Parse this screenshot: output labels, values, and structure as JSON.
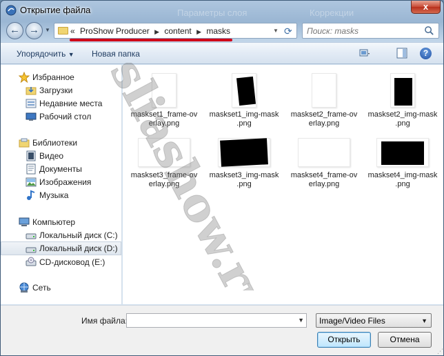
{
  "window": {
    "title": "Открытие файла",
    "background_ghost_left": "Параметры слоя",
    "background_ghost_right": "Коррекции",
    "close_label": "x"
  },
  "navigation": {
    "back_icon": "back-arrow-icon",
    "forward_icon": "forward-arrow-icon",
    "address": {
      "overflow_marker": "«",
      "crumbs": [
        "ProShow Producer",
        "content",
        "masks"
      ]
    },
    "search_placeholder": "Поиск: masks"
  },
  "toolbar": {
    "organize_label": "Упорядочить",
    "new_folder_label": "Новая папка",
    "help_label": "?"
  },
  "sidebar": {
    "items": [
      {
        "label": "Избранное",
        "icon": "star-icon",
        "level": 0
      },
      {
        "label": "Загрузки",
        "icon": "downloads-folder-icon",
        "level": 1
      },
      {
        "label": "Недавние места",
        "icon": "recent-places-icon",
        "level": 1
      },
      {
        "label": "Рабочий стол",
        "icon": "desktop-icon",
        "level": 1
      },
      {
        "label": "Библиотеки",
        "icon": "libraries-icon",
        "level": 0
      },
      {
        "label": "Видео",
        "icon": "video-library-icon",
        "level": 1
      },
      {
        "label": "Документы",
        "icon": "documents-library-icon",
        "level": 1
      },
      {
        "label": "Изображения",
        "icon": "pictures-library-icon",
        "level": 1
      },
      {
        "label": "Музыка",
        "icon": "music-library-icon",
        "level": 1
      },
      {
        "label": "Компьютер",
        "icon": "computer-icon",
        "level": 0
      },
      {
        "label": "Локальный диск (C:)",
        "icon": "drive-icon",
        "level": 1
      },
      {
        "label": "Локальный диск (D:)",
        "icon": "drive-icon",
        "level": 1,
        "selected": true
      },
      {
        "label": "CD-дисковод (E:)",
        "icon": "cd-drive-icon",
        "level": 1
      },
      {
        "label": "Сеть",
        "icon": "network-icon",
        "level": 0
      }
    ]
  },
  "files": [
    {
      "name": "maskset1_frame-overlay.png",
      "line1": "maskset1_frame-ov",
      "line2": "erlay.png",
      "thumb": "white-portrait"
    },
    {
      "name": "maskset1_img-mask.png",
      "line1": "maskset1_img-mask",
      "line2": ".png",
      "thumb": "black-portrait-tilted"
    },
    {
      "name": "maskset2_frame-overlay.png",
      "line1": "maskset2_frame-ov",
      "line2": "erlay.png",
      "thumb": "white-portrait"
    },
    {
      "name": "maskset2_img-mask.png",
      "line1": "maskset2_img-mask",
      "line2": ".png",
      "thumb": "black-portrait"
    },
    {
      "name": "maskset3_frame-overlay.png",
      "line1": "maskset3_frame-ov",
      "line2": "erlay.png",
      "thumb": "white-landscape"
    },
    {
      "name": "maskset3_img-mask.png",
      "line1": "maskset3_img-mask",
      "line2": ".png",
      "thumb": "black-landscape-tilted"
    },
    {
      "name": "maskset4_frame-overlay.png",
      "line1": "maskset4_frame-ov",
      "line2": "erlay.png",
      "thumb": "white-landscape"
    },
    {
      "name": "maskset4_img-mask.png",
      "line1": "maskset4_img-mask",
      "line2": ".png",
      "thumb": "black-landscape"
    }
  ],
  "watermark": {
    "text": "sliashow.ru"
  },
  "footer": {
    "filename_label": "Имя файла:",
    "filename_value": "",
    "filter_value": "Image/Video Files",
    "open_label": "Открыть",
    "cancel_label": "Отмена"
  }
}
